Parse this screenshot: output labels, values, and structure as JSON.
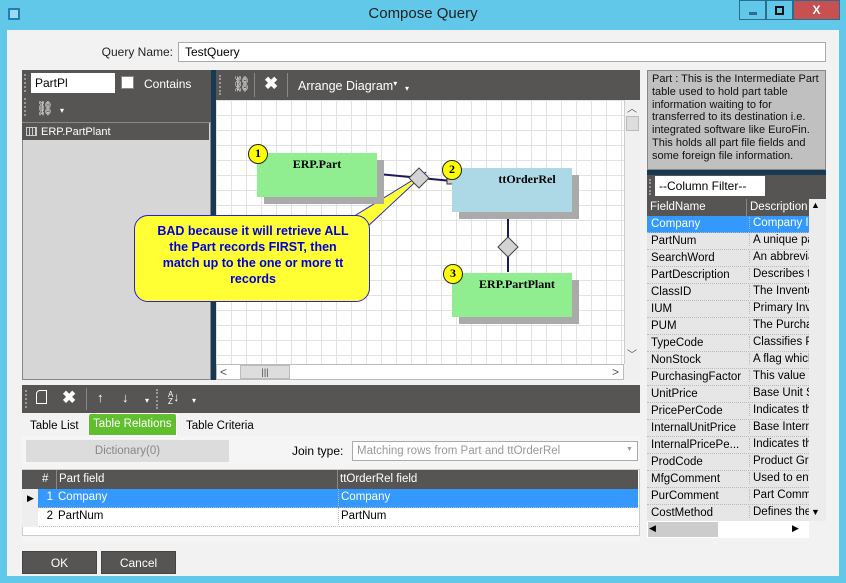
{
  "window": {
    "title": "Compose Query",
    "minimize_label": "—",
    "maximize_label": "□",
    "close_label": "X"
  },
  "query_name": {
    "label": "Query Name:",
    "value": "TestQuery"
  },
  "table_search": {
    "value": "PartPl",
    "contains_label": "Contains",
    "contains_checked": false
  },
  "table_list": [
    {
      "label": "ERP.PartPlant",
      "icon": "table-icon"
    }
  ],
  "diagram_toolbar": {
    "arrange_label": "Arrange Diagram"
  },
  "diagram": {
    "nodes": [
      {
        "badge": "1",
        "label": "ERP.Part",
        "color": "#90ee90"
      },
      {
        "badge": "2",
        "label": "ttOrderRel",
        "color": "#add8e6"
      },
      {
        "badge": "3",
        "label": "ERP.PartPlant",
        "color": "#90ee90"
      }
    ],
    "callout": {
      "lines": [
        "BAD because it will retrieve ALL",
        "the Part records FIRST, then",
        "match up to the one or more tt",
        "records"
      ],
      "bg": "#ffff33",
      "text_color": "#0000dd"
    }
  },
  "info_text": "Part : This is the Intermediate Part table used to hold part table information waiting to for transferred to its destination i.e. integrated software like EuroFin. This holds all part file fields and some foreign file information.",
  "column_filter": {
    "value": "--Column Filter--"
  },
  "fields_grid": {
    "headers": [
      "FieldName",
      "Description"
    ],
    "rows": [
      {
        "name": "Company",
        "desc": "Company Id",
        "selected": true
      },
      {
        "name": "PartNum",
        "desc": "A unique pa"
      },
      {
        "name": "SearchWord",
        "desc": "An abbrevia"
      },
      {
        "name": "PartDescription",
        "desc": "Describes th"
      },
      {
        "name": "ClassID",
        "desc": "The Invento"
      },
      {
        "name": "IUM",
        "desc": "Primary Inve"
      },
      {
        "name": "PUM",
        "desc": "The Purchas"
      },
      {
        "name": "TypeCode",
        "desc": "Classifies P"
      },
      {
        "name": "NonStock",
        "desc": "A flag which"
      },
      {
        "name": "PurchasingFactor",
        "desc": "This value is"
      },
      {
        "name": "UnitPrice",
        "desc": "Base Unit S"
      },
      {
        "name": "PricePerCode",
        "desc": "Indicates th"
      },
      {
        "name": "InternalUnitPrice",
        "desc": "Base Intern"
      },
      {
        "name": "InternalPricePe...",
        "desc": "Indicates th"
      },
      {
        "name": "ProdCode",
        "desc": "Product Gro"
      },
      {
        "name": "MfgComment",
        "desc": "Used to ent"
      },
      {
        "name": "PurComment",
        "desc": "Part Comme"
      },
      {
        "name": "CostMethod",
        "desc": "Defines the"
      }
    ]
  },
  "tabs": [
    {
      "label": "Table List"
    },
    {
      "label": "Table Relations",
      "active": true
    },
    {
      "label": "Table Criteria"
    }
  ],
  "relations": {
    "dictionary_label": "Dictionary(0)",
    "join_type_label": "Join type:",
    "join_type_value": "Matching rows from Part and ttOrderRel",
    "headers": [
      "#",
      "Part field",
      "ttOrderRel field"
    ],
    "rows": [
      {
        "num": "1",
        "part_field": "Company",
        "rel_field": "Company",
        "selected": true
      },
      {
        "num": "2",
        "part_field": "PartNum",
        "rel_field": "PartNum"
      }
    ]
  },
  "buttons": {
    "ok": "OK",
    "cancel": "Cancel"
  },
  "icons": {
    "link": "⛓",
    "delete": "✖",
    "up": "🡑",
    "down": "🡓",
    "sort": "A↓Z",
    "dropdown": "▾"
  }
}
